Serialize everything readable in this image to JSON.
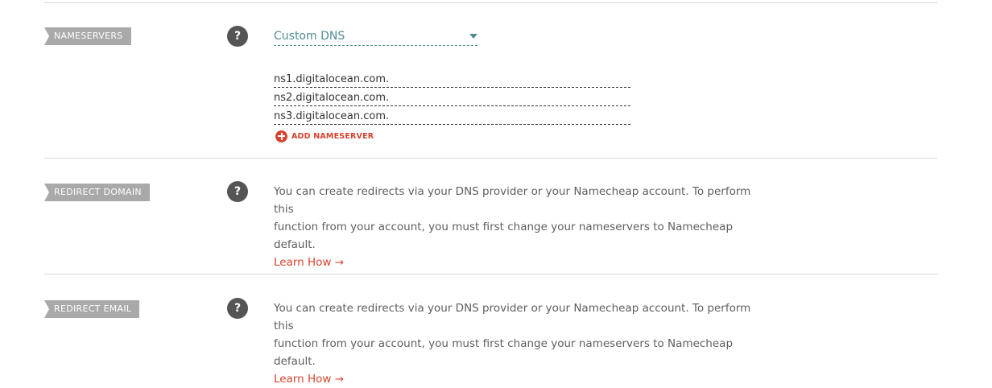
{
  "sections": {
    "nameservers": {
      "label": "NAMESERVERS",
      "help_icon": "?",
      "mode_select": {
        "value": "Custom DNS"
      },
      "entries": [
        "ns1.digitalocean.com.",
        "ns2.digitalocean.com.",
        "ns3.digitalocean.com."
      ],
      "add_label": "ADD NAMESERVER"
    },
    "redirect_domain": {
      "label": "REDIRECT DOMAIN",
      "help_icon": "?",
      "line1": "You can create redirects via your DNS provider or your Namecheap account. To perform this",
      "line2": "function from your account, you must first change your nameservers to Namecheap default.",
      "link": "Learn How →"
    },
    "redirect_email": {
      "label": "REDIRECT EMAIL",
      "help_icon": "?",
      "line1": "You can create redirects via your DNS provider or your Namecheap account. To perform this",
      "line2": "function from your account, you must first change your nameservers to Namecheap default.",
      "link": "Learn How →"
    }
  },
  "icons": {
    "help": "question-icon",
    "dropdown": "caret-down-icon",
    "add": "plus-circle-icon"
  },
  "colors": {
    "accent_red": "#d7432e",
    "teal": "#4f8d94",
    "tag_gray": "#a9a9a9",
    "help_gray": "#555555"
  }
}
